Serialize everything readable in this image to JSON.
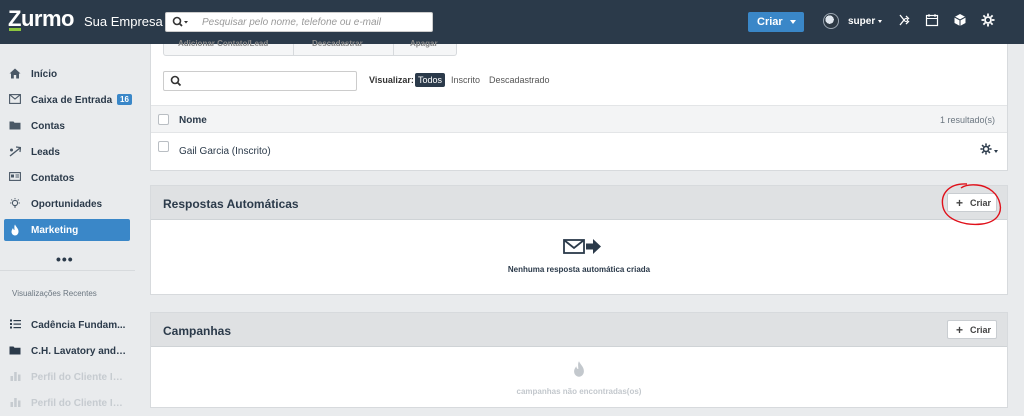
{
  "header": {
    "logo": "Zurmo",
    "company": "Sua Empresa",
    "search_placeholder": "Pesquisar pelo nome, telefone ou e-mail",
    "create_label": "Criar",
    "user_name": "super",
    "icons": [
      "magnifier-icon",
      "mission-icon",
      "calendar-icon",
      "box-icon",
      "gear-icon"
    ]
  },
  "sidebar": {
    "items": [
      {
        "label": "Início",
        "icon": "home-icon"
      },
      {
        "label": "Caixa de Entrada",
        "icon": "inbox-icon",
        "badge": "16"
      },
      {
        "label": "Contas",
        "icon": "folder-icon"
      },
      {
        "label": "Leads",
        "icon": "leads-icon"
      },
      {
        "label": "Contatos",
        "icon": "contact-card-icon"
      },
      {
        "label": "Oportunidades",
        "icon": "lightbulb-icon"
      },
      {
        "label": "Marketing",
        "icon": "flame-icon",
        "active": true
      }
    ],
    "more": "•••",
    "recent_heading": "Visualizações Recentes",
    "recent": [
      {
        "label": "Cadência Fundam...",
        "icon": "list-icon"
      },
      {
        "label": "C.H. Lavatory and ...",
        "icon": "folder-icon"
      },
      {
        "label": "Perfil do Cliente Id...",
        "icon": "chart-icon",
        "faded": true
      },
      {
        "label": "Perfil do Cliente Id...",
        "icon": "chart-icon",
        "faded": true
      }
    ]
  },
  "list": {
    "toolbar": [
      "Adicionar Contato/Lead",
      "Descadastrar",
      "Apagar"
    ],
    "view_label": "Visualizar:",
    "view_options": [
      "Todos",
      "Inscrito",
      "Descadastrado"
    ],
    "selected_view": "Todos",
    "column_header": "Nome",
    "result_count": "1 resultado(s)",
    "rows": [
      {
        "name": "Gail Garcia (Inscrito)"
      }
    ]
  },
  "autoresponders": {
    "title": "Respostas Automáticas",
    "create_label": "Criar",
    "empty_text": "Nenhuma resposta automática criada"
  },
  "campaigns": {
    "title": "Campanhas",
    "create_label": "Criar",
    "empty_text": "campanhas não encontradas(os)"
  },
  "colors": {
    "header_bg": "#2b3a4a",
    "accent": "#3a87c8",
    "annotation": "#e0101a"
  }
}
